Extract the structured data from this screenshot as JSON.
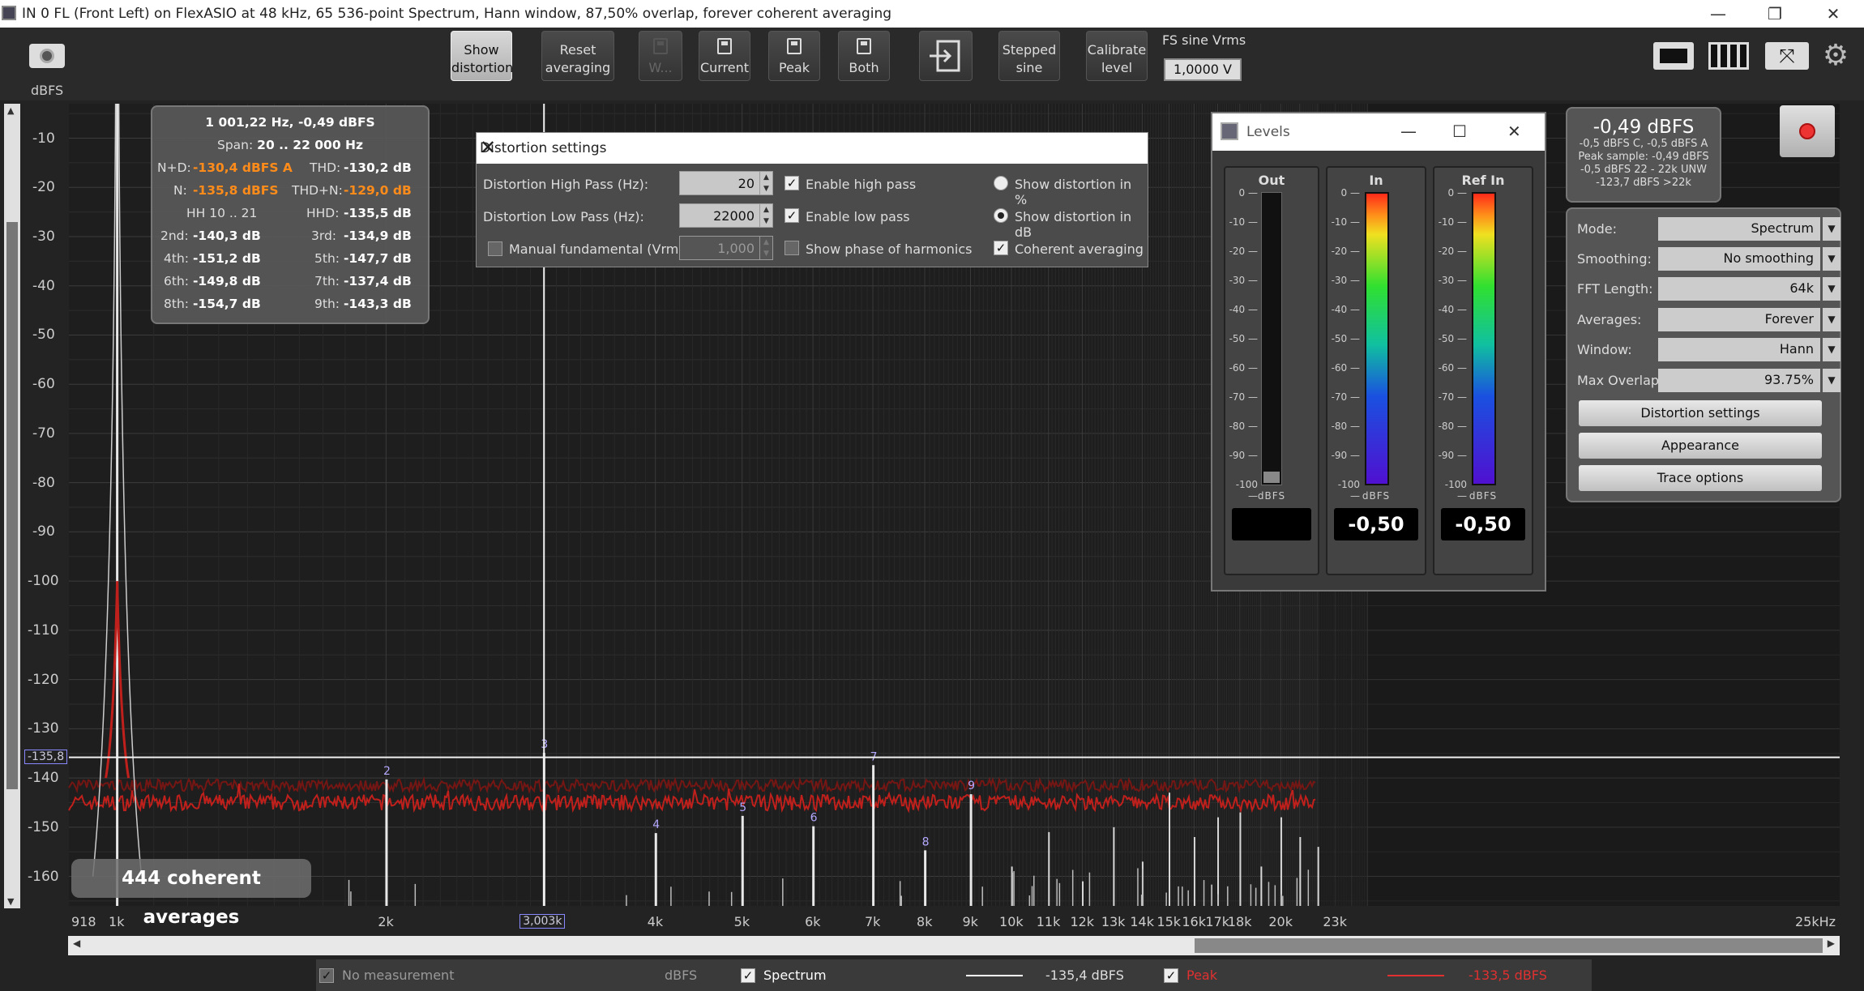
{
  "window": {
    "title": "IN 0 FL (Front Left) on FlexASIO at 48 kHz, 65 536-point Spectrum, Hann window, 87,50% overlap, forever coherent averaging",
    "minimize": "—",
    "maximize": "❐",
    "close": "✕"
  },
  "toolbar": {
    "show_distortion": [
      "Show",
      "distortion"
    ],
    "reset_averaging": [
      "Reset",
      "averaging"
    ],
    "w": "W...",
    "current": "Current",
    "peak": "Peak",
    "both": "Both",
    "stepped_sine": [
      "Stepped",
      "sine"
    ],
    "calibrate_level": [
      "Calibrate",
      "level"
    ],
    "fs_label": "FS sine Vrms",
    "fs_value": "1,0000 V"
  },
  "plot": {
    "y_unit": "dBFS",
    "y_ticks": [
      "-10",
      "-20",
      "-30",
      "-40",
      "-50",
      "-60",
      "-70",
      "-80",
      "-90",
      "-100",
      "-110",
      "-120",
      "-130",
      "-140",
      "-150",
      "-160"
    ],
    "x_ticks": [
      "918",
      "1k",
      "2k",
      "3,003k",
      "4k",
      "5k",
      "6k",
      "7k",
      "8k",
      "9k",
      "10k",
      "11k",
      "12k",
      "13k",
      "14k",
      "15k",
      "16k",
      "17k",
      "18k",
      "20k",
      "23k",
      "25kHz"
    ],
    "cursor_y_label": "-135,8",
    "cursor_x_label": "3,003k",
    "harmonic_labels": [
      "2",
      "3",
      "4",
      "5",
      "6",
      "7",
      "8",
      "9"
    ],
    "averages_label": "444 coherent averages"
  },
  "info": {
    "line1": "1 001,22 Hz, -0,49 dBFS",
    "span_label": "Span:",
    "span_value": "20 .. 22 000 Hz",
    "nd_label": "N+D:",
    "nd_value": "-130,4 dBFS A",
    "thd_label": "THD:",
    "thd_value": "-130,2 dB",
    "n_label": "N:",
    "n_value": "-135,8 dBFS",
    "thdn_label": "THD+N:",
    "thdn_value": "-129,0 dB",
    "hh": "HH 10 .. 21",
    "hhd_label": "HHD:",
    "hhd_value": "-135,5 dB",
    "h2_label": "2nd:",
    "h2": "-140,3 dB",
    "h3_label": "3rd:",
    "h3": "-134,9 dB",
    "h4_label": "4th:",
    "h4": "-151,2 dB",
    "h5_label": "5th:",
    "h5": "-147,7 dB",
    "h6_label": "6th:",
    "h6": "-149,8 dB",
    "h7_label": "7th:",
    "h7": "-137,4 dB",
    "h8_label": "8th:",
    "h8": "-154,7 dB",
    "h9_label": "9th:",
    "h9": "-143,3 dB"
  },
  "distortion_settings": {
    "title": "Distortion settings",
    "close": "✕",
    "high_pass_label": "Distortion High Pass (Hz):",
    "high_pass_value": "20",
    "low_pass_label": "Distortion Low Pass (Hz):",
    "low_pass_value": "22000",
    "manual_fundamental_label": "Manual fundamental (Vrms)",
    "manual_fundamental_value": "1,000",
    "enable_high_pass": "Enable high pass",
    "enable_low_pass": "Enable low pass",
    "show_phase": "Show phase of harmonics",
    "show_pct": "Show distortion in %",
    "show_db": "Show distortion in dB",
    "coherent": "Coherent averaging"
  },
  "levels": {
    "title": "Levels",
    "out_title": "Out",
    "in_title": "In",
    "refin_title": "Ref In",
    "unit": "dBFS",
    "ticks": [
      "0",
      "-10",
      "-20",
      "-30",
      "-40",
      "-50",
      "-60",
      "-70",
      "-80",
      "-90",
      "-100"
    ],
    "out_value": "",
    "in_value": "-0,50",
    "refin_value": "-0,50"
  },
  "peak_panel": {
    "big": "-0,49 dBFS",
    "l1": "-0,5 dBFS C, -0,5 dBFS A",
    "l2": "Peak sample: -0,49 dBFS",
    "l3": "-0,5 dBFS 22 - 22k UNW",
    "l4": "-123,7 dBFS >22k"
  },
  "controls": {
    "mode_label": "Mode:",
    "mode": "Spectrum",
    "smoothing_label": "Smoothing:",
    "smoothing": "No smoothing",
    "fft_label": "FFT Length:",
    "fft": "64k",
    "averages_label": "Averages:",
    "averages": "Forever",
    "window_label": "Window:",
    "window": "Hann",
    "overlap_label": "Max Overlap:",
    "overlap": "93.75%",
    "distortion_btn": "Distortion settings",
    "appearance_btn": "Appearance",
    "trace_btn": "Trace options"
  },
  "legend": {
    "no_measurement": "No measurement",
    "unit": "dBFS",
    "spectrum": "Spectrum",
    "spectrum_value": "-135,4 dBFS",
    "peak": "Peak",
    "peak_value": "-133,5 dBFS"
  },
  "colors": {
    "trace": "#c0201c",
    "peak_trace": "#e03030",
    "accent_orange": "#ff8c1a"
  }
}
